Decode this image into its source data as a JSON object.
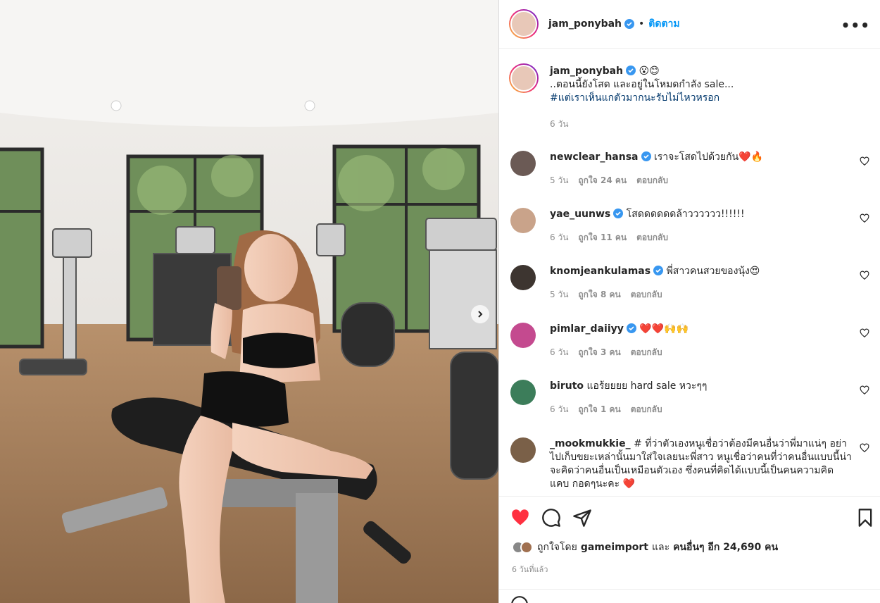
{
  "post": {
    "username": "jam_ponybah",
    "follow_label": "ติดตาม",
    "dot": "•",
    "more_label": "•••"
  },
  "caption": {
    "username": "jam_ponybah",
    "emojis": "😮😊",
    "line1": "..ตอนนี้ยังโสด และอยู่ในโหมดกำลัง sale...",
    "hashtag": "#แต่เราเห็นแกตัวมากนะรับไม่ไหวหรอก",
    "time": "6 วัน"
  },
  "comments": [
    {
      "username": "newclear_hansa",
      "verified": true,
      "text": "เราจะโสดไปด้วยกัน❤️🔥",
      "time": "5 วัน",
      "likes": "ถูกใจ 24 คน",
      "reply": "ตอบกลับ",
      "avatar_color": "#6b5a55"
    },
    {
      "username": "yae_uunws",
      "verified": true,
      "text": "โสดดดดดดล้าวววววว!!!!!!",
      "time": "6 วัน",
      "likes": "ถูกใจ 11 คน",
      "reply": "ตอบกลับ",
      "avatar_color": "#c9a38a"
    },
    {
      "username": "knomjeankulamas",
      "verified": true,
      "text": "พี่สาวคนสวยของนุ้ง😍",
      "time": "5 วัน",
      "likes": "ถูกใจ 8 คน",
      "reply": "ตอบกลับ",
      "avatar_color": "#3d3530"
    },
    {
      "username": "pimlar_daiiyy",
      "verified": true,
      "text": "❤️❤️🙌🙌",
      "time": "6 วัน",
      "likes": "ถูกใจ 3 คน",
      "reply": "ตอบกลับ",
      "avatar_color": "#c44a8f"
    },
    {
      "username": "biruto",
      "verified": false,
      "text": "แอร้ยยยย hard sale หวะๆๆ",
      "time": "6 วัน",
      "likes": "ถูกใจ 1 คน",
      "reply": "ตอบกลับ",
      "avatar_color": "#3c7d5a"
    },
    {
      "username": "_mookmukkie_",
      "verified": false,
      "text": "# ที่ว่าตัวเองหนูเชื่อว่าต้องมีคนอื่นว่าพี่มาแน่ๆ อย่าไปเก็บขยะเหล่านั้นมาใส่ใจเลยนะพี่สาว หนูเชื่อว่าคนที่ว่าคนอื่นแบบนี้น่าจะคิดว่าคนอื่นเป็นเหมือนตัวเอง ซึ่งคนที่คิดได้แบบนี้เป็นคนความคิดแคบ กอดๆนะคะ ❤️",
      "time": "",
      "likes": "",
      "reply": "",
      "avatar_color": "#7a6048"
    }
  ],
  "likes_summary": {
    "prefix": "ถูกใจโดย",
    "user": "gameimport",
    "and": "และ",
    "others": "คนอื่นๆ อีก 24,690 คน"
  },
  "date": "6 วันที่แล้ว",
  "colors": {
    "accent": "#0095f6",
    "like_red": "#ff3040",
    "verified": "#3897f0"
  }
}
